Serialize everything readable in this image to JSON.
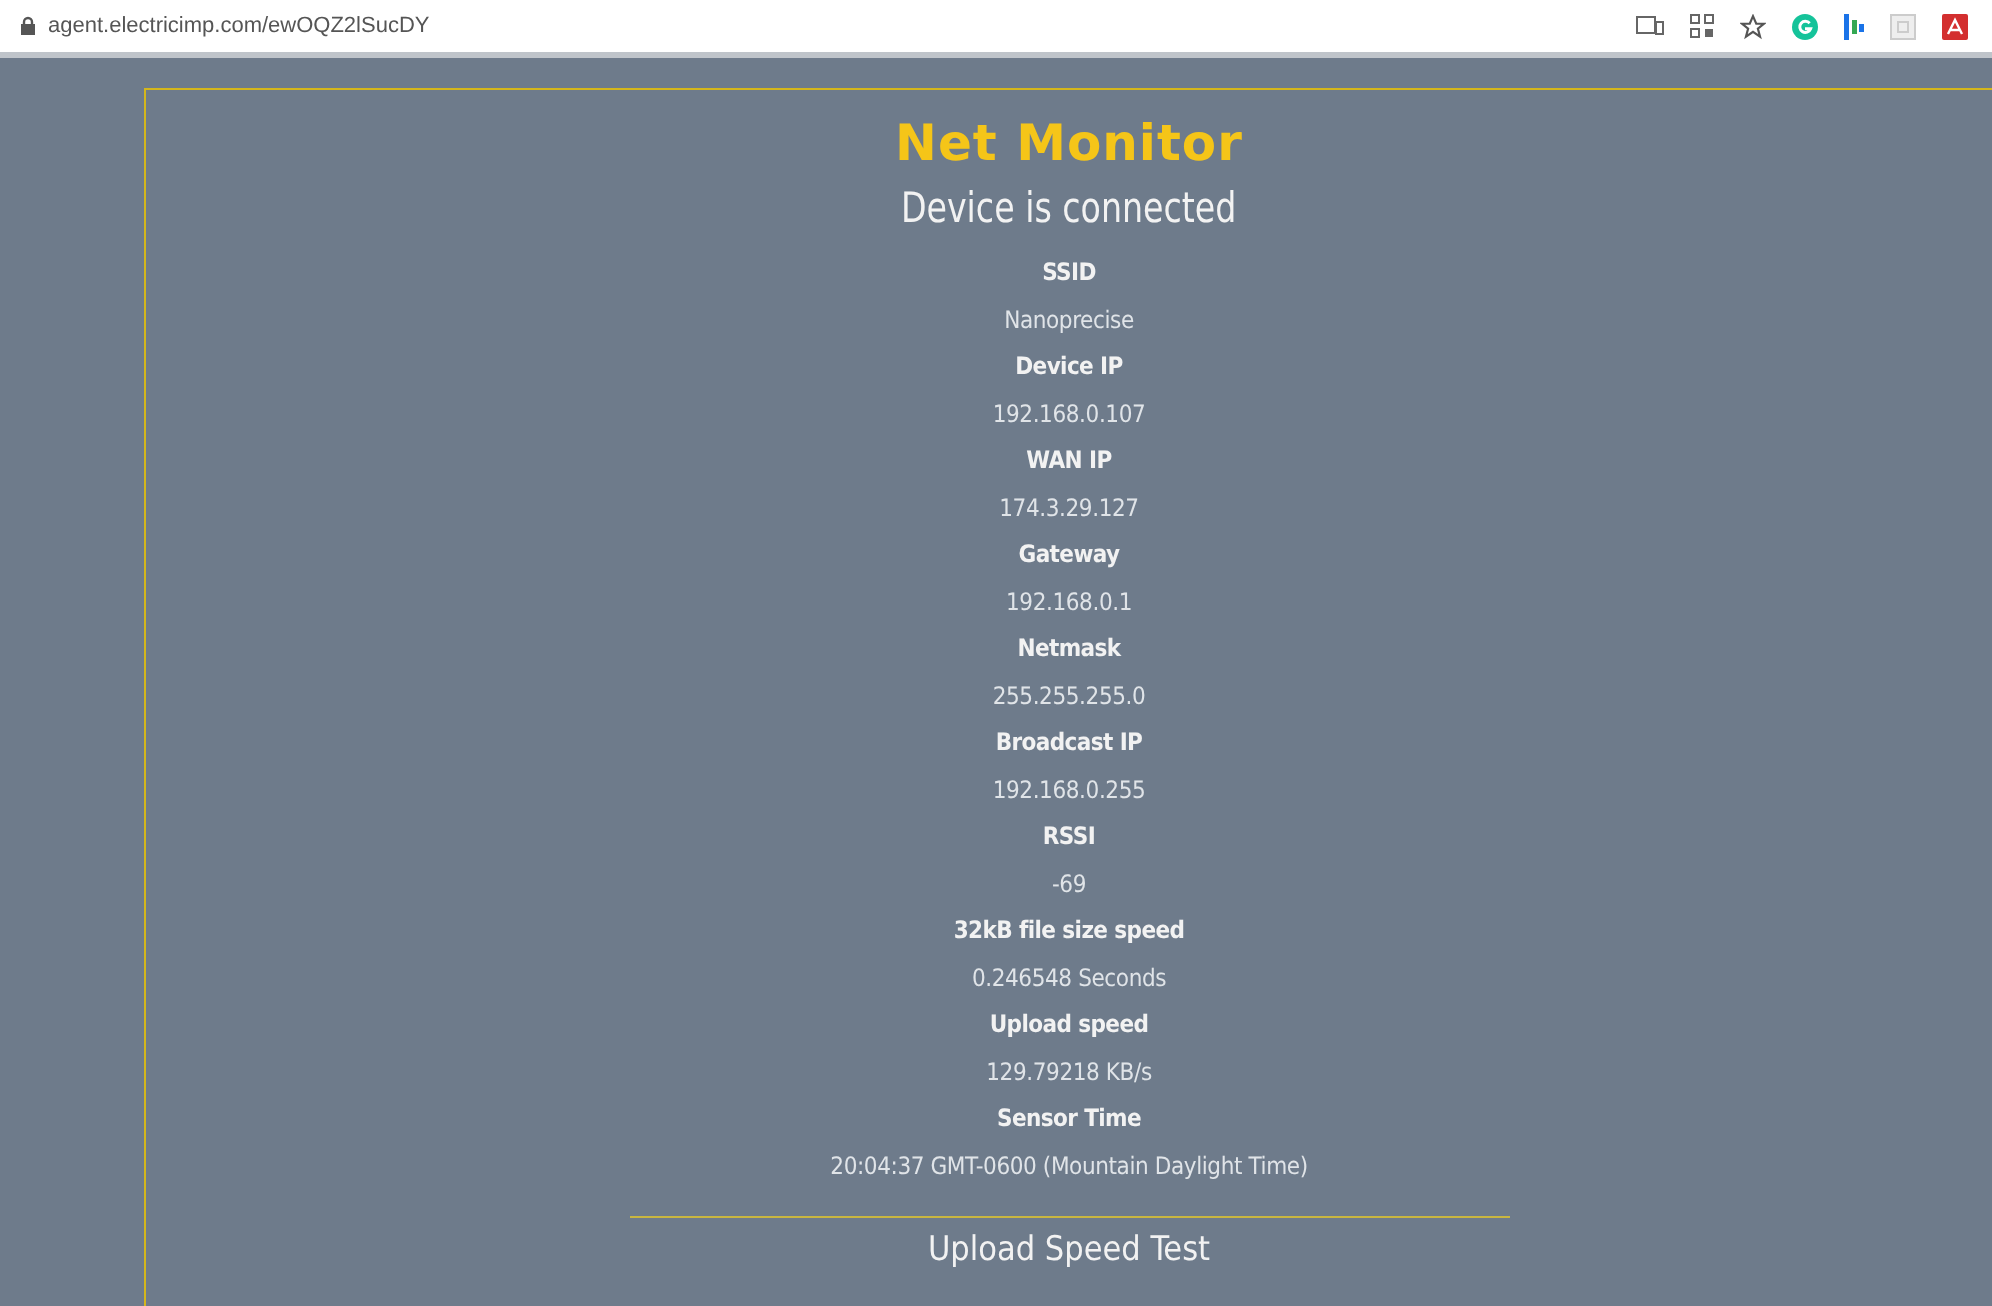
{
  "address_bar": {
    "url": "agent.electricimp.com/ewOQZ2lSucDY"
  },
  "title": "Net Monitor",
  "status": "Device is connected",
  "fields": [
    {
      "label": "SSID",
      "value": "Nanoprecise"
    },
    {
      "label": "Device IP",
      "value": "192.168.0.107"
    },
    {
      "label": "WAN IP",
      "value": "174.3.29.127"
    },
    {
      "label": "Gateway",
      "value": "192.168.0.1"
    },
    {
      "label": "Netmask",
      "value": "255.255.255.0"
    },
    {
      "label": "Broadcast IP",
      "value": "192.168.0.255"
    },
    {
      "label": "RSSI",
      "value": "-69"
    },
    {
      "label": "32kB file size speed",
      "value": "0.246548 Seconds"
    },
    {
      "label": "Upload speed",
      "value": "129.79218 KB/s"
    },
    {
      "label": "Sensor Time",
      "value": "20:04:37 GMT-0600 (Mountain Daylight Time)"
    }
  ],
  "section_heading": "Upload Speed Test"
}
